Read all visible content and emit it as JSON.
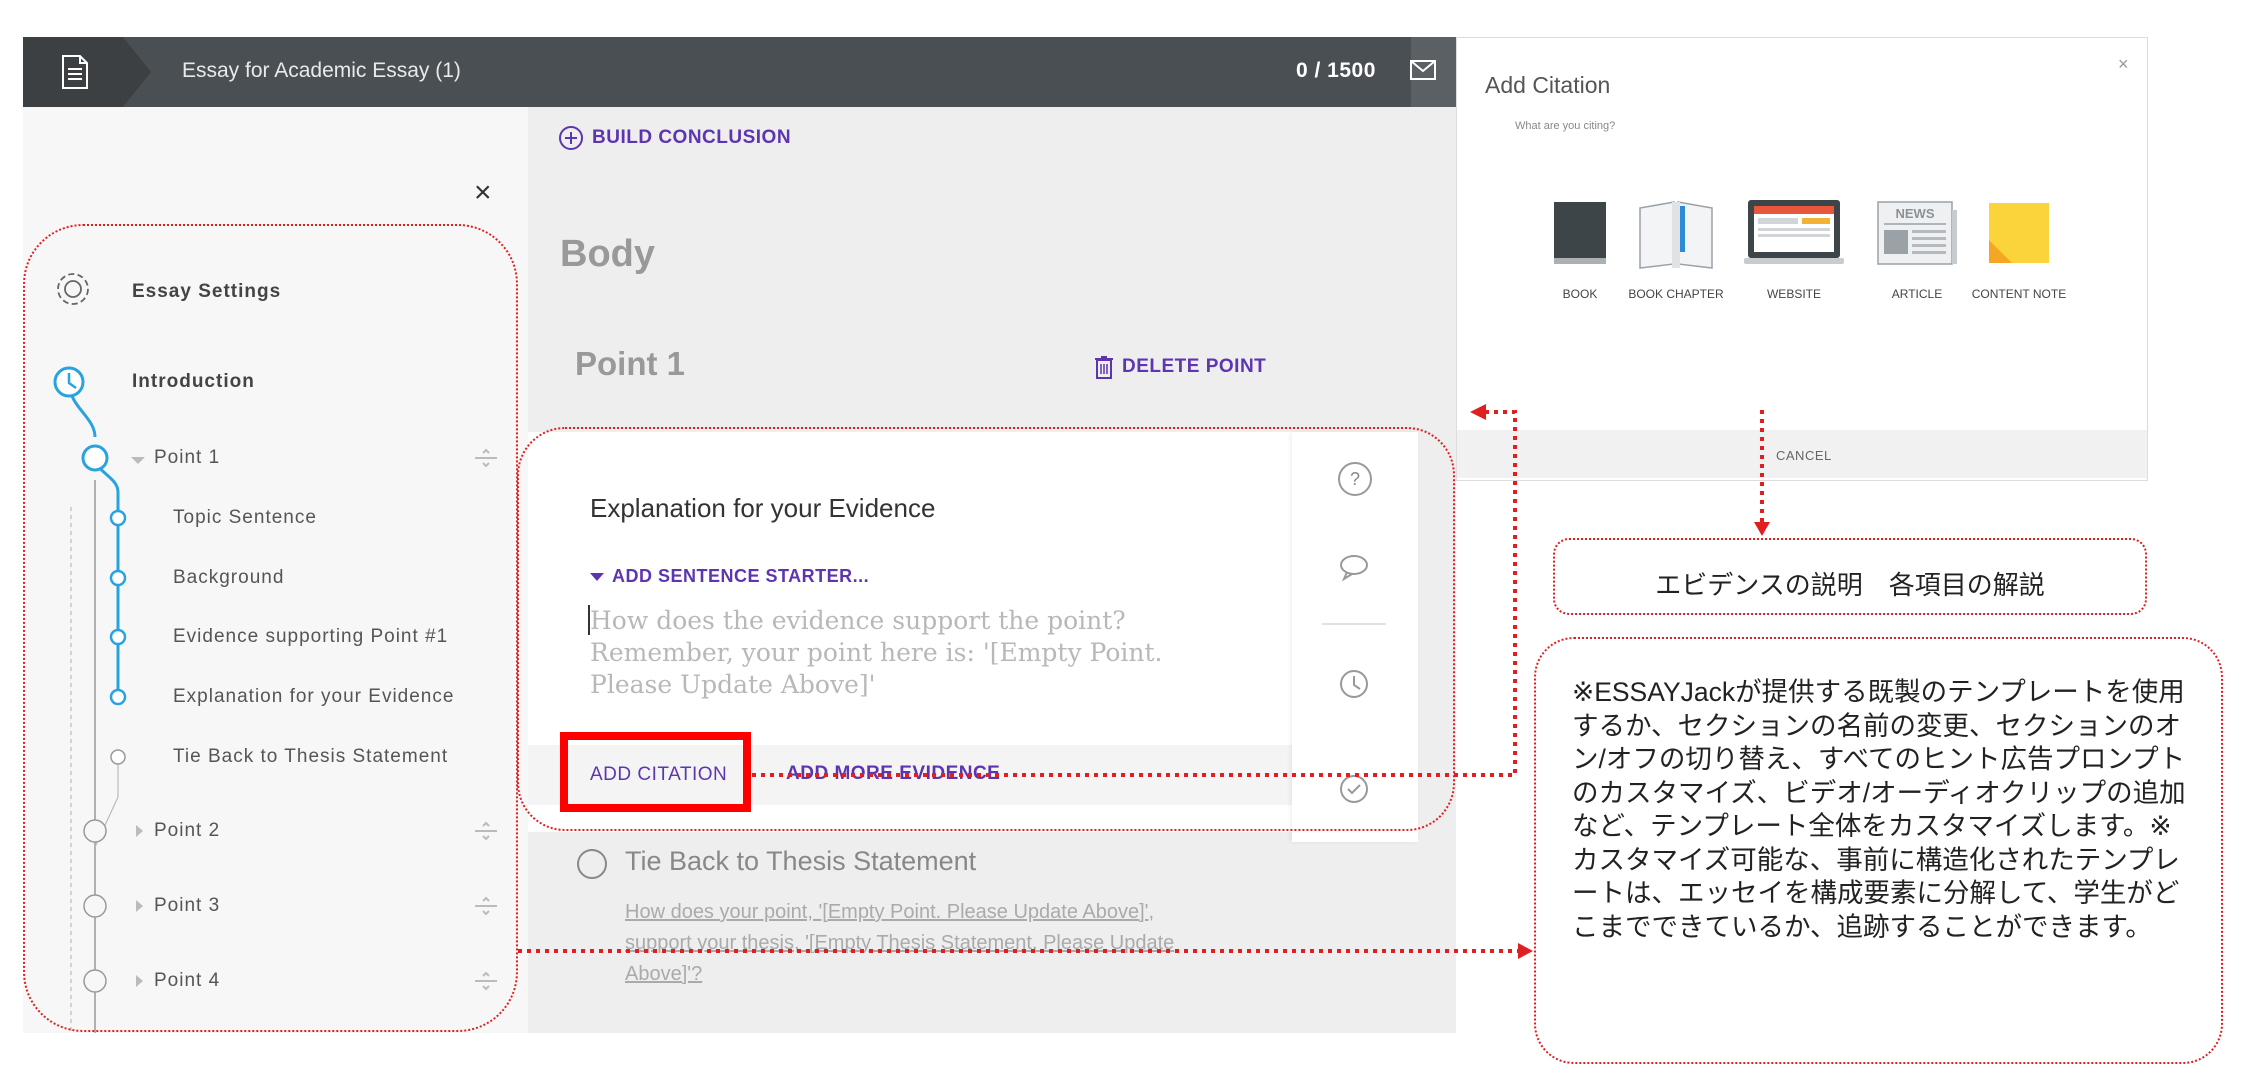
{
  "topbar": {
    "title": "Essay for Academic Essay (1)",
    "word_count": "0 / 1500"
  },
  "sidebar": {
    "settings_label": "Essay Settings",
    "introduction_label": "Introduction",
    "items": [
      {
        "label": "Point 1"
      },
      {
        "label": "Topic Sentence"
      },
      {
        "label": "Background"
      },
      {
        "label": "Evidence supporting Point #1"
      },
      {
        "label": "Explanation for your Evidence"
      },
      {
        "label": "Tie Back to Thesis Statement"
      },
      {
        "label": "Point 2"
      },
      {
        "label": "Point 3"
      },
      {
        "label": "Point 4"
      }
    ]
  },
  "main": {
    "build_conclusion": "BUILD CONCLUSION",
    "section_title": "Body",
    "point_title": "Point 1",
    "delete_point": "DELETE POINT",
    "card": {
      "title": "Explanation for your Evidence",
      "add_sentence_starter": "ADD SENTENCE STARTER...",
      "prompt": "How does the evidence support the point? Remember, your point here is: '[Empty Point. Please Update Above]'",
      "add_citation": "ADD CITATION",
      "add_more_evidence": "ADD MORE EVIDENCE"
    },
    "tieback": {
      "title": "Tie Back to Thesis Statement",
      "prompt": "How does your point, '[Empty Point. Please Update Above]', support your thesis, '[Empty Thesis Statement. Please Update Above]'?"
    }
  },
  "dialog": {
    "title": "Add Citation",
    "subtitle": "What are you citing?",
    "options": [
      {
        "label": "BOOK",
        "icon": "book-icon"
      },
      {
        "label": "BOOK CHAPTER",
        "icon": "book-chapter-icon"
      },
      {
        "label": "WEBSITE",
        "icon": "website-icon"
      },
      {
        "label": "ARTICLE",
        "icon": "article-icon"
      },
      {
        "label": "CONTENT NOTE",
        "icon": "content-note-icon"
      }
    ],
    "article_icon_text": "NEWS",
    "cancel": "CANCEL",
    "close_symbol": "×"
  },
  "annotations": {
    "small_box": "エビデンスの説明　各項目の解説",
    "big_box": "※ESSAYJackが提供する既製のテンプレートを使用するか、セクションの名前の変更、セクションのオン/オフの切り替え、すべてのヒント広告プロンプトのカスタマイズ、ビデオ/オーディオクリップの追加など、テンプレート全体をカスタマイズします。※カスタマイズ可能な、事前に構造化されたテンプレートは、エッセイを構成要素に分解して、学生がどこまでできているか、追跡することができます。"
  },
  "colors": {
    "accent_purple": "#5e35b1",
    "timeline_blue": "#29a3df",
    "annotation_red": "#e02020",
    "topbar_dark": "#4a4f53"
  }
}
